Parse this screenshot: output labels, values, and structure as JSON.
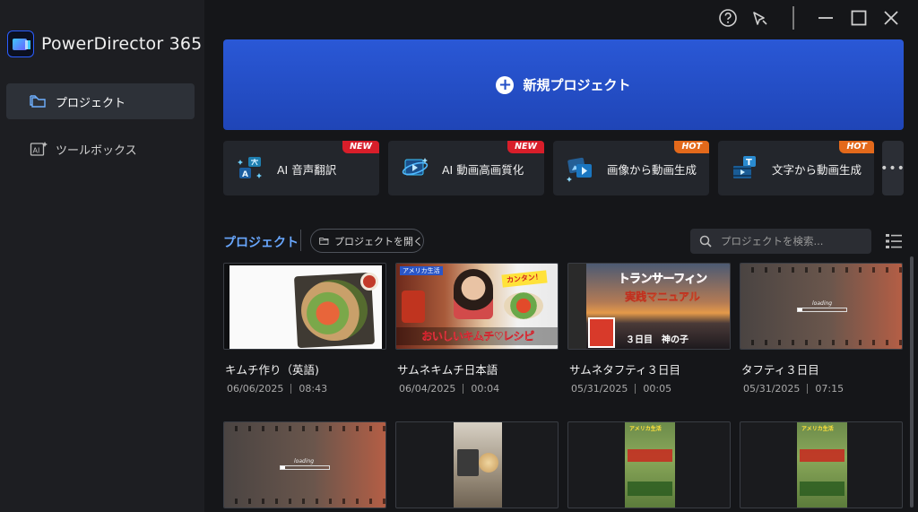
{
  "app": {
    "title": "PowerDirector 365"
  },
  "sidebar": {
    "items": [
      {
        "label": "プロジェクト",
        "icon": "folder-icon",
        "active": true
      },
      {
        "label": "ツールボックス",
        "icon": "ai-toolbox-icon",
        "active": false
      }
    ]
  },
  "titlebar": {
    "icons": [
      "help-icon",
      "notification-icon",
      "minimize-icon",
      "maximize-icon",
      "close-icon"
    ]
  },
  "hero": {
    "label": "新規プロジェクト",
    "icon": "plus-circle-icon"
  },
  "tools": [
    {
      "label": "AI 音声翻訳",
      "badge": "NEW",
      "icon": "voice-translate-icon"
    },
    {
      "label": "AI 動画高画質化",
      "badge": "NEW",
      "icon": "video-enhance-icon"
    },
    {
      "label": "画像から動画生成",
      "badge": "HOT",
      "icon": "image-to-video-icon"
    },
    {
      "label": "文字から動画生成",
      "badge": "HOT",
      "icon": "text-to-video-icon"
    }
  ],
  "more_tools": {
    "label": "•••"
  },
  "projects_section": {
    "title": "プロジェクト",
    "open_label": "プロジェクトを開く",
    "search_placeholder": "プロジェクトを検索..."
  },
  "projects": [
    {
      "name": "キムチ作り（英語)",
      "date": "06/06/2025",
      "duration": "08:43"
    },
    {
      "name": "サムネキムチ日本語",
      "date": "06/04/2025",
      "duration": "00:04"
    },
    {
      "name": "サムネタフティ３日目",
      "date": "05/31/2025",
      "duration": "00:05"
    },
    {
      "name": "タフティ３日目",
      "date": "05/31/2025",
      "duration": "07:15"
    }
  ],
  "thumb_text": {
    "kimchi_top": "アメリカ生活",
    "kimchi_tag": "カンタン！",
    "kimchi_title": "おいしいキムチ♡レシピ",
    "tufti_title1": "トランサーフィン",
    "tufti_title2": "実践マニュアル",
    "tufti_day": "３日目　神の子",
    "loading": "loading",
    "amerika": "アメリカ生活"
  }
}
